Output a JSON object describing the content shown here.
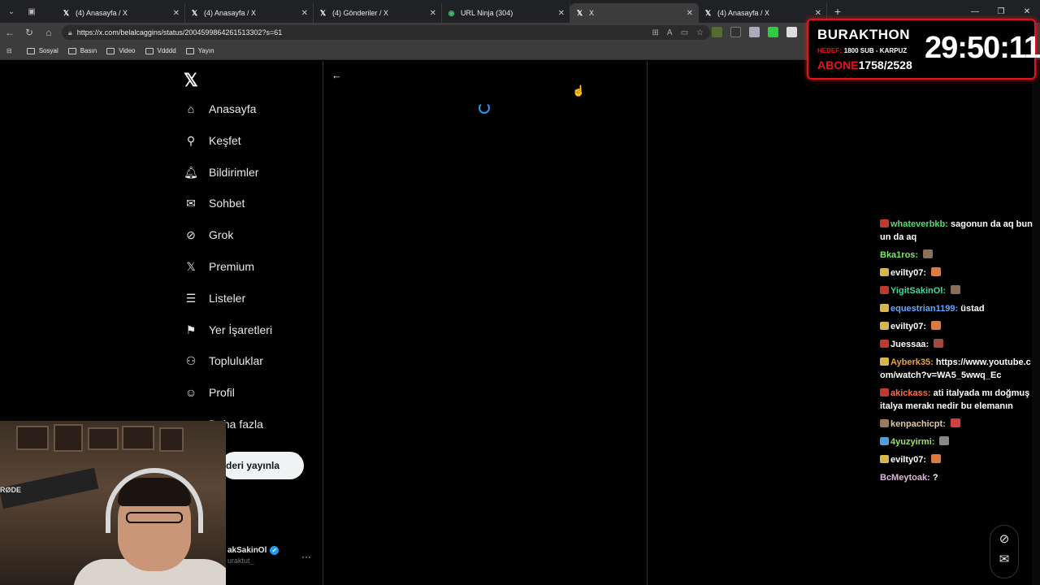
{
  "browser": {
    "tabs": [
      {
        "title": "(4) Anasayfa / X",
        "icon": "x-logo-icon",
        "active": false
      },
      {
        "title": "(4) Anasayfa / X",
        "icon": "x-logo-icon",
        "active": false
      },
      {
        "title": "(4) Gönderiler / X",
        "icon": "x-logo-icon",
        "active": false
      },
      {
        "title": "URL Ninja (304)",
        "icon": "ninja-icon",
        "active": false
      },
      {
        "title": "X",
        "icon": "x-logo-icon",
        "active": true
      },
      {
        "title": "(4) Anasayfa / X",
        "icon": "x-logo-icon",
        "active": false
      }
    ],
    "url": "https://x.com/belalcaggins/status/2004599864261513302?s=61",
    "bookmarks": [
      "Sosyal",
      "Basın",
      "Video",
      "Vdddd",
      "Yayın"
    ]
  },
  "sidebar": {
    "items": [
      {
        "label": "Anasayfa",
        "icon": "home-icon"
      },
      {
        "label": "Keşfet",
        "icon": "search-icon"
      },
      {
        "label": "Bildirimler",
        "icon": "bell-icon"
      },
      {
        "label": "Sohbet",
        "icon": "mail-icon"
      },
      {
        "label": "Grok",
        "icon": "grok-icon"
      },
      {
        "label": "Premium",
        "icon": "x-premium-icon"
      },
      {
        "label": "Listeler",
        "icon": "list-icon"
      },
      {
        "label": "Yer İşaretleri",
        "icon": "bookmark-icon"
      },
      {
        "label": "Topluluklar",
        "icon": "communities-icon"
      },
      {
        "label": "Profil",
        "icon": "profile-icon"
      },
      {
        "label": "Daha fazla",
        "icon": "more-icon"
      }
    ],
    "post_button": "deri yayınla",
    "account": {
      "name": "akSakinOl",
      "handle": "uraktut_"
    }
  },
  "stream_overlay": {
    "title": "BURAKTHON",
    "hedef_label": "HEDEF:",
    "hedef_value": "1800 SUB - KARPUZ",
    "abone_label": "ABONE",
    "abone_value": "1758/2528",
    "timer": "29:50:11"
  },
  "webcam": {
    "mic_brand": "RØDE"
  },
  "chat": [
    {
      "user": "whateverbkb",
      "color": "#4ade6e",
      "badge": "#c0392b",
      "text": "sagonun da aq bunun da aq",
      "emote": null
    },
    {
      "user": "Bka1ros",
      "color": "#7ee86a",
      "badge": null,
      "text": "",
      "emote": "#8a6d5a"
    },
    {
      "user": "evilty07",
      "color": "#ffffff",
      "badge": "#d6b84a",
      "text": "",
      "emote": "#e07a3a"
    },
    {
      "user": "YigitSakinOl",
      "color": "#3fd6a0",
      "badge": "#c0392b",
      "text": "",
      "emote": "#8a6d5a"
    },
    {
      "user": "equestrian1199",
      "color": "#5fa8ff",
      "badge": "#d6b84a",
      "text": "üstad",
      "emote": null
    },
    {
      "user": "evilty07",
      "color": "#ffffff",
      "badge": "#d6b84a",
      "text": "",
      "emote": "#e07a3a"
    },
    {
      "user": "Juessaa",
      "color": "#ffffff",
      "badge": "#c0392b",
      "text": "",
      "emote": "#a04a3a"
    },
    {
      "user": "Ayberk35",
      "color": "#e8a23a",
      "badge": "#d6b84a",
      "text": "https://www.youtube.com/watch?v=WA5_5wwq_Ec",
      "emote": null
    },
    {
      "user": "akickass",
      "color": "#ff6a3a",
      "badge": "#c0392b",
      "text": "ati italyada mı doğmuş italya merakı nedir bu elemanın",
      "emote": null
    },
    {
      "user": "kenpachicpt",
      "color": "#e0c8a8",
      "badge": "#9a7a5a",
      "text": "",
      "emote": "#d04040"
    },
    {
      "user": "4yuzyirmi",
      "color": "#9be06a",
      "badge": "#4aa0e0",
      "text": "",
      "emote": "#888888"
    },
    {
      "user": "evilty07",
      "color": "#ffffff",
      "badge": "#d6b84a",
      "text": "",
      "emote": "#e07a3a"
    },
    {
      "user": "BcMeytoak",
      "color": "#d8b8d8",
      "badge": null,
      "text": "?",
      "emote": null
    }
  ],
  "colors": {
    "accent": "#1d9bf0",
    "overlay_red": "#e3131b"
  }
}
